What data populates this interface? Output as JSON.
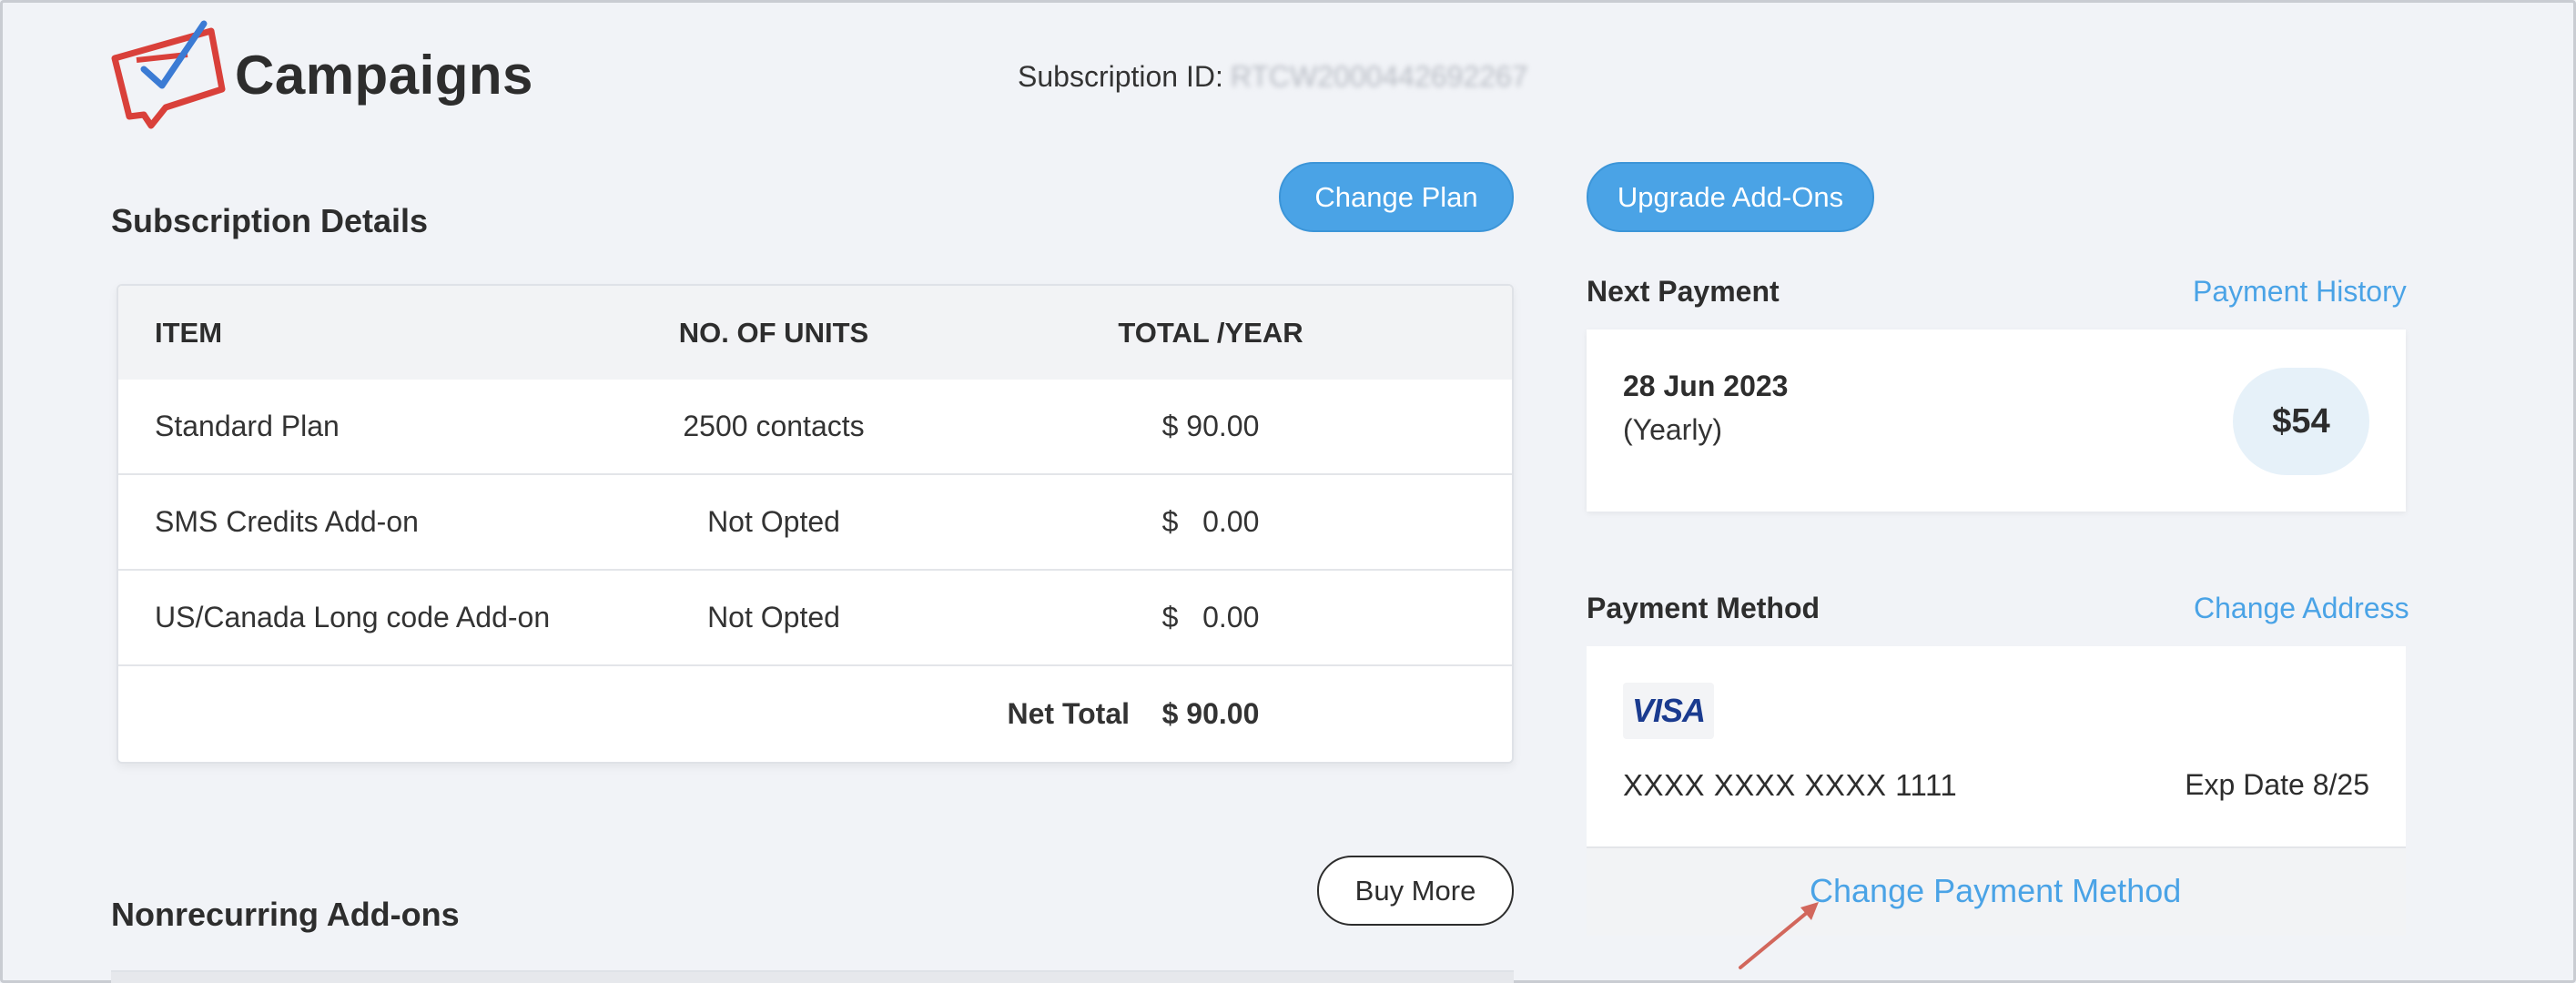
{
  "header": {
    "app_title": "Campaigns",
    "subscription_id_label": "Subscription ID:",
    "subscription_id_value": "RTCW2000442692267"
  },
  "buttons": {
    "change_plan": "Change Plan",
    "upgrade_addons": "Upgrade Add-Ons",
    "buy_more": "Buy More"
  },
  "subscription": {
    "title": "Subscription Details",
    "columns": [
      "ITEM",
      "NO. OF UNITS",
      "TOTAL /YEAR"
    ],
    "rows": [
      {
        "item": "Standard Plan",
        "units": "2500 contacts",
        "total": "$ 90.00"
      },
      {
        "item": "SMS Credits Add-on",
        "units": "Not Opted",
        "total": "$   0.00"
      },
      {
        "item": "US/Canada Long code Add-on",
        "units": "Not Opted",
        "total": "$   0.00"
      }
    ],
    "net_total_label": "Net Total",
    "net_total_value": "$ 90.00"
  },
  "nonrecurring": {
    "title": "Nonrecurring Add-ons"
  },
  "next_payment": {
    "label": "Next Payment",
    "history_link": "Payment History",
    "date": "28 Jun 2023",
    "cycle": "(Yearly)",
    "amount": "$54"
  },
  "payment_method": {
    "label": "Payment Method",
    "change_address_link": "Change Address",
    "card_brand": "VISA",
    "card_number": "XXXX XXXX XXXX 1111",
    "expiry": "Exp Date 8/25",
    "change_link": "Change Payment Method"
  },
  "colors": {
    "accent": "#4aa3e6",
    "logo_red": "#d9403a",
    "logo_blue": "#3b7bd4",
    "annotation_arrow": "#d2675c"
  },
  "icons": {
    "logo": "campaigns-logo-icon",
    "visa": "visa-card-icon",
    "arrow": "annotation-arrow-icon"
  }
}
